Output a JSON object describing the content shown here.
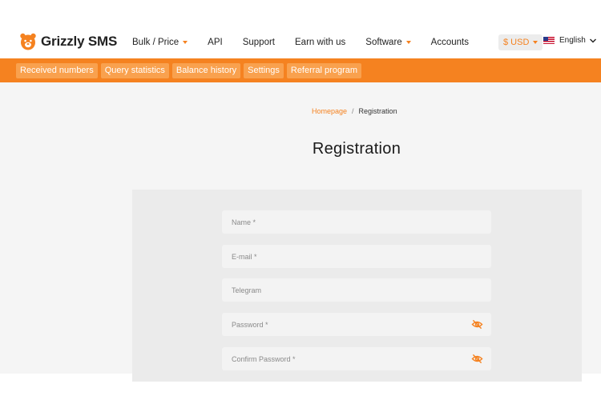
{
  "header": {
    "brand": "Grizzly SMS",
    "nav": [
      {
        "label": "Bulk / Price",
        "dropdown": true
      },
      {
        "label": "API",
        "dropdown": false
      },
      {
        "label": "Support",
        "dropdown": false
      },
      {
        "label": "Earn with us",
        "dropdown": false
      },
      {
        "label": "Software",
        "dropdown": true
      },
      {
        "label": "Accounts",
        "dropdown": false
      }
    ],
    "currency": "$ USD",
    "language": "English"
  },
  "subnav": [
    "Received numbers",
    "Query statistics",
    "Balance history",
    "Settings",
    "Referral program"
  ],
  "breadcrumb": {
    "home": "Homepage",
    "separator": "/",
    "current": "Registration"
  },
  "page_title": "Registration",
  "form": {
    "name_placeholder": "Name *",
    "email_placeholder": "E-mail *",
    "telegram_placeholder": "Telegram",
    "password_placeholder": "Password *",
    "confirm_placeholder": "Confirm Password *"
  },
  "colors": {
    "accent": "#f58220",
    "subnav_chip": "#f9a14e",
    "panel": "#ebebeb"
  },
  "icons": {
    "logo": "bear-icon",
    "password_toggle": "eye-off-icon",
    "language_toggle": "chevron-down-icon"
  }
}
